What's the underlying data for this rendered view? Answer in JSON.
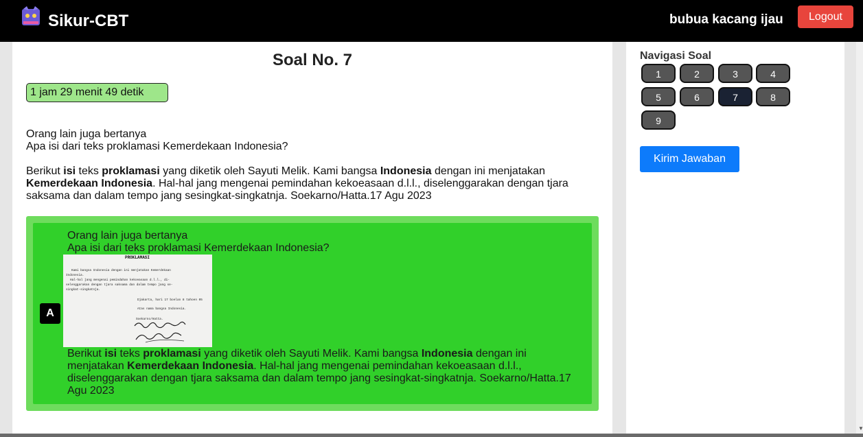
{
  "header": {
    "brand": "Sikur-CBT",
    "username": "bubua kacang ijau",
    "logout_label": "Logout"
  },
  "question": {
    "title": "Soal No. 7",
    "timer": "1 jam 29 menit 49 detik",
    "line1": "Orang lain juga bertanya",
    "line2": "Apa isi dari teks proklamasi Kemerdekaan Indonesia?",
    "p_a": "Berikut ",
    "p_b": "isi",
    "p_c": " teks ",
    "p_d": "proklamasi",
    "p_e": " yang diketik oleh Sayuti Melik. Kami bangsa ",
    "p_f": "Indonesia",
    "p_g": " dengan ini menjatakan ",
    "p_h": "Kemerdekaan Indonesia",
    "p_i": ". Hal-hal jang mengenai pemindahan kekoeasaan d.l.l., diselenggarakan dengan tjara saksama dan dalam tempo jang sesingkat-singkatnja. Soekarno/Hatta.17 Agu 2023"
  },
  "option": {
    "letter": "A",
    "line1": "Orang lain juga bertanya",
    "line2": "Apa isi dari teks proklamasi Kemerdekaan Indonesia?",
    "doc": {
      "heading": "PROKLAMASI",
      "l1": "Kami bangsa Indonesia dengan ini menjatakan Kemerdekaan",
      "l2": "Indonesia.",
      "l3": "Hal-hal jang mengenai pemindahan kekoeasaan d.l.l., di-",
      "l4": "selenggarakan dengan tjara saksama dan dalam tempo jang se-",
      "l5": "singkat-singkatnja.",
      "place": "Djakarta, hari 17 boelan 8 tahoen 05",
      "onbehalf": "Atas nama bangsa Indonesia.",
      "names": "Soekarno/Hatta."
    },
    "p_a": "Berikut ",
    "p_b": "isi",
    "p_c": " teks ",
    "p_d": "proklamasi",
    "p_e": " yang diketik oleh Sayuti Melik. Kami bangsa ",
    "p_f": "Indonesia",
    "p_g": " dengan ini menjatakan ",
    "p_h": "Kemerdekaan Indonesia",
    "p_i": ". Hal-hal jang mengenai pemindahan kekoeasaan d.l.l., diselenggarakan dengan tjara saksama dan dalam tempo jang sesingkat-singkatnja. Soekarno/Hatta.17 Agu 2023"
  },
  "sidebar": {
    "nav_title": "Navigasi Soal",
    "numbers": [
      "1",
      "2",
      "3",
      "4",
      "5",
      "6",
      "7",
      "8",
      "9"
    ],
    "active": "7",
    "submit_label": "Kirim Jawaban"
  },
  "colors": {
    "topbar": "#000000",
    "logout": "#e8453c",
    "timer_bg": "#9ee68a",
    "answer_outer": "#6edc5d",
    "answer_inner": "#31d02a",
    "submit": "#0d7bfb",
    "nav_button": "#555555",
    "nav_active": "#1a2233"
  }
}
